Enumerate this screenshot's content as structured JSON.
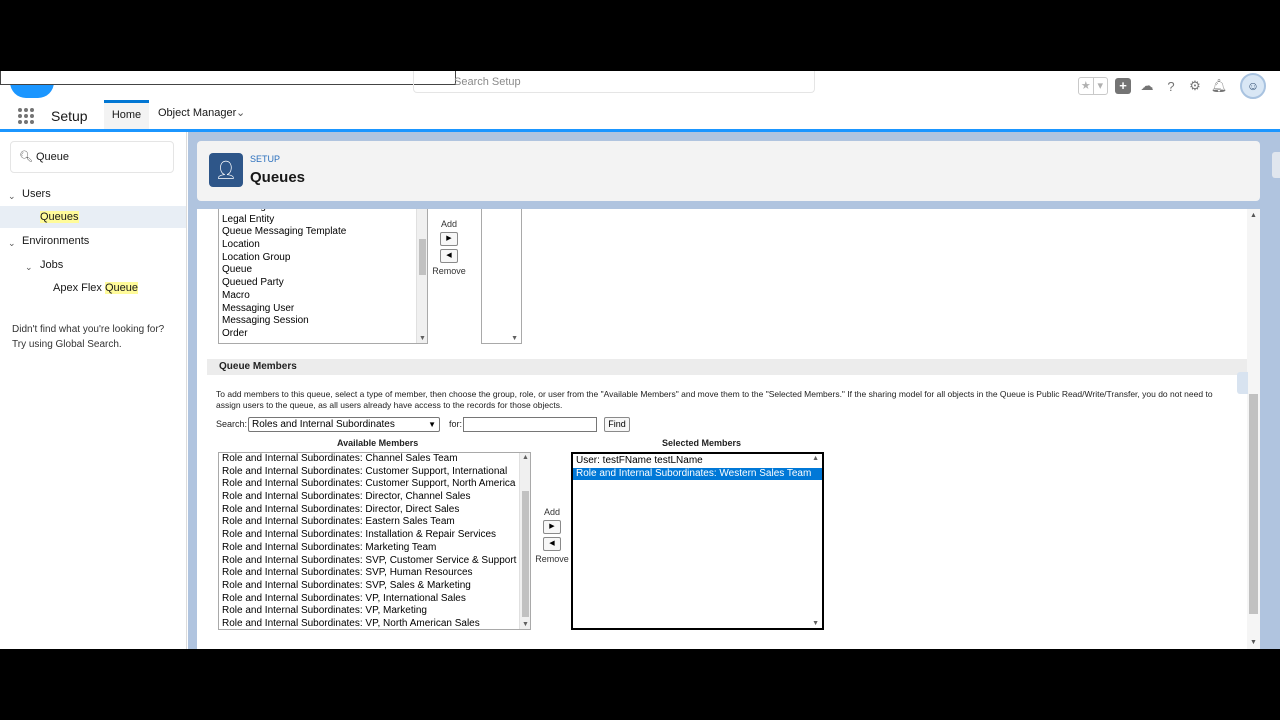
{
  "header": {
    "search_placeholder": "Search Setup",
    "avatar_icon": "avatar-icon"
  },
  "nav": {
    "app_name": "Setup",
    "tabs": [
      {
        "label": "Home"
      },
      {
        "label": "Object Manager"
      }
    ]
  },
  "sidebar": {
    "quick_find_value": "Queue",
    "users_label": "Users",
    "queues_label": "Queues",
    "environments_label": "Environments",
    "jobs_label": "Jobs",
    "apex_prefix": "Apex Flex ",
    "apex_hl": "Queue",
    "notfound_line1": "Didn't find what you're looking for?",
    "notfound_line2": "Try using Global Search."
  },
  "page_header": {
    "eyebrow": "SETUP",
    "title": "Queues"
  },
  "objects_picklist": {
    "available": [
      "Knowledge Article Version",
      "Legal Entity",
      "Queue Messaging Template",
      "Location",
      "Location Group",
      "Queue",
      "Queued Party",
      "Macro",
      "Messaging User",
      "Messaging Session",
      "Order"
    ],
    "add_label": "Add",
    "remove_label": "Remove"
  },
  "queue_members": {
    "section_title": "Queue Members",
    "description": "To add members to this queue, select a type of member, then choose the group, role, or user from the \"Available Members\" and move them to the \"Selected Members.\" If the sharing model for all objects in the Queue is Public Read/Write/Transfer, you do not need to assign users to the queue, as all users already have access to the records for those objects.",
    "search_label": "Search:",
    "search_type": "Roles and Internal Subordinates",
    "for_label": "for:",
    "find_label": "Find",
    "available_header": "Available Members",
    "selected_header": "Selected Members",
    "add_label": "Add",
    "remove_label": "Remove",
    "available": [
      "Role and Internal Subordinates: Channel Sales Team",
      "Role and Internal Subordinates: Customer Support, International",
      "Role and Internal Subordinates: Customer Support, North America",
      "Role and Internal Subordinates: Director, Channel Sales",
      "Role and Internal Subordinates: Director, Direct Sales",
      "Role and Internal Subordinates: Eastern Sales Team",
      "Role and Internal Subordinates: Installation & Repair Services",
      "Role and Internal Subordinates: Marketing Team",
      "Role and Internal Subordinates: SVP, Customer Service & Support",
      "Role and Internal Subordinates: SVP, Human Resources",
      "Role and Internal Subordinates: SVP, Sales & Marketing",
      "Role and Internal Subordinates: VP, International Sales",
      "Role and Internal Subordinates: VP, Marketing",
      "Role and Internal Subordinates: VP, North American Sales"
    ],
    "selected": [
      "User: testFName testLName",
      "Role and Internal Subordinates: Western Sales Team"
    ]
  }
}
